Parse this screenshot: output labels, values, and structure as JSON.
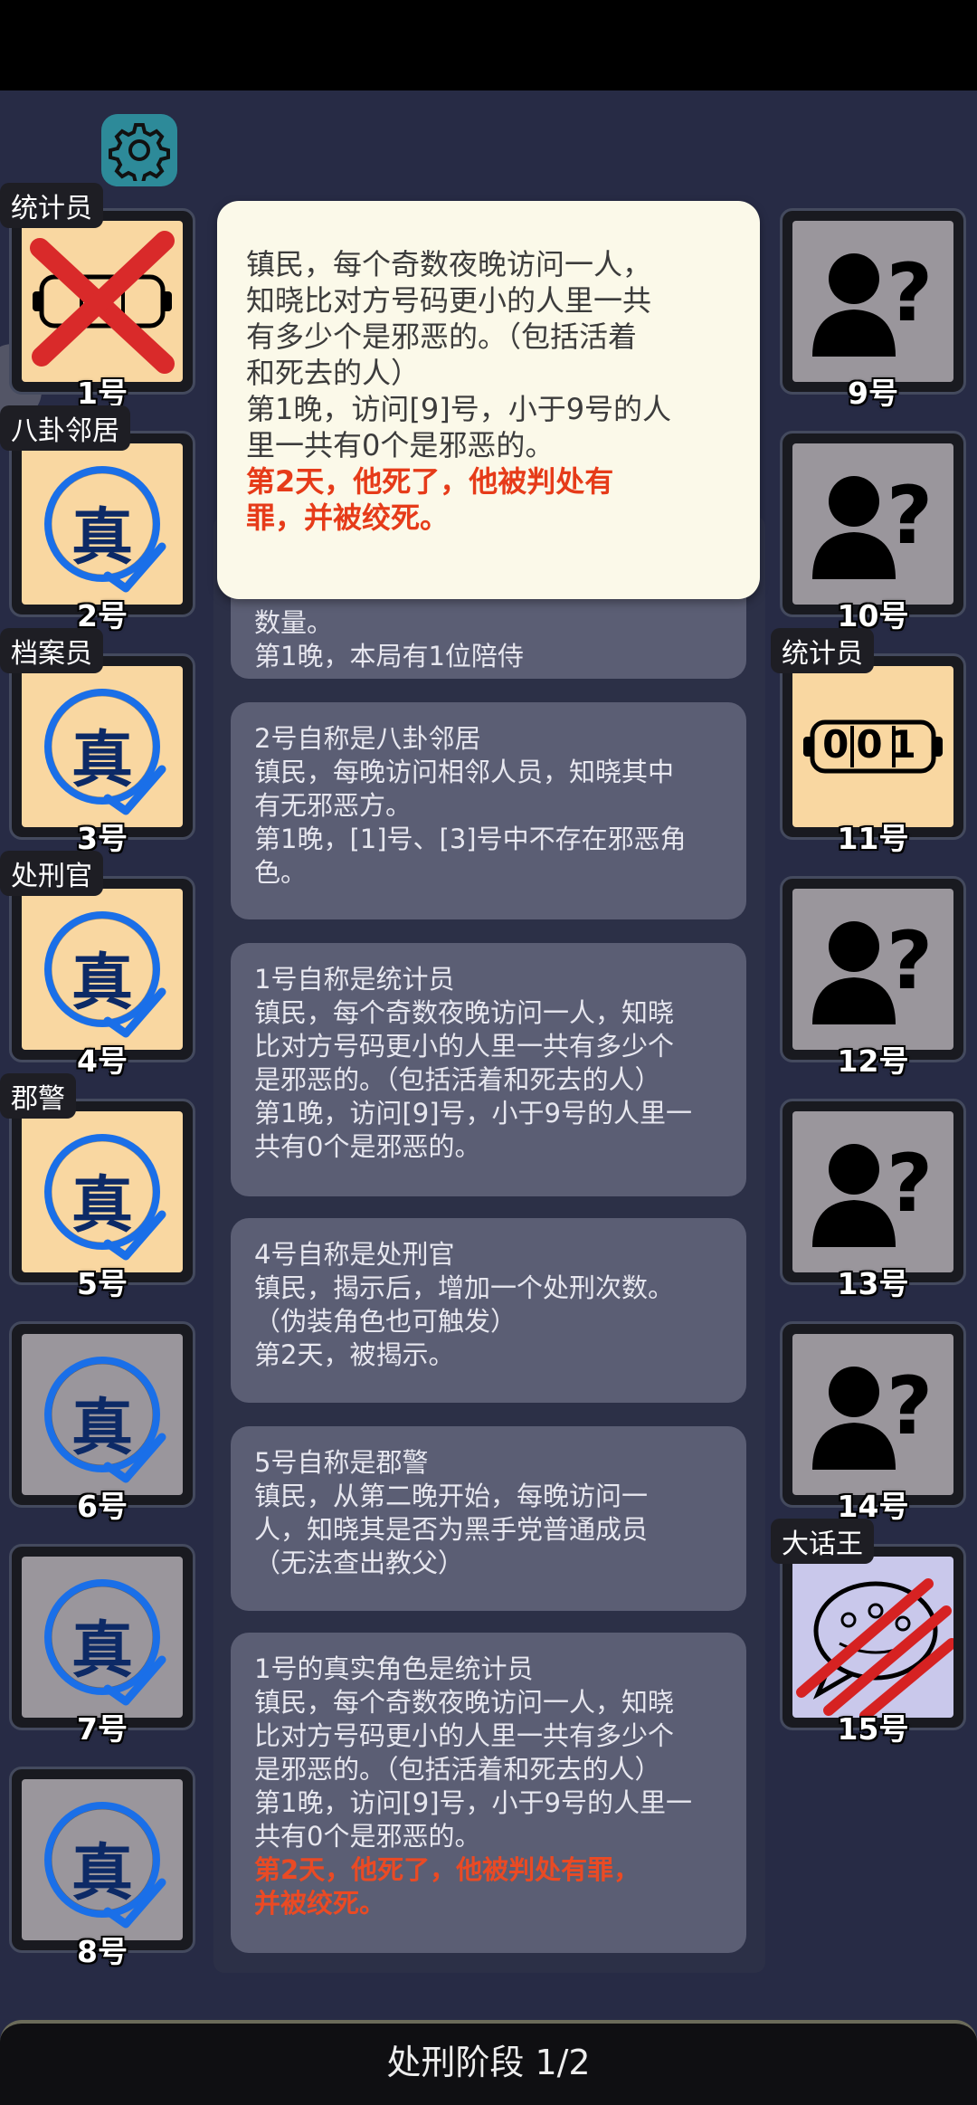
{
  "settings": {
    "icon": "gear-icon"
  },
  "seats": [
    {
      "number": "1号",
      "role_label": "统计员",
      "state": "dead",
      "icon": "counter-icon"
    },
    {
      "number": "2号",
      "role_label": "八卦邻居",
      "state": "verified",
      "badge": "真"
    },
    {
      "number": "3号",
      "role_label": "档案员",
      "state": "verified",
      "badge": "真"
    },
    {
      "number": "4号",
      "role_label": "处刑官",
      "state": "verified",
      "badge": "真"
    },
    {
      "number": "5号",
      "role_label": "郡警",
      "state": "verified",
      "badge": "真"
    },
    {
      "number": "6号",
      "state": "verified",
      "badge": "真"
    },
    {
      "number": "7号",
      "state": "verified",
      "badge": "真"
    },
    {
      "number": "8号",
      "state": "verified",
      "badge": "真"
    },
    {
      "number": "9号",
      "state": "unknown",
      "icon": "unknown-person-icon"
    },
    {
      "number": "10号",
      "state": "unknown",
      "icon": "unknown-person-icon"
    },
    {
      "number": "11号",
      "role_label": "统计员",
      "state": "revealed",
      "icon": "counter-icon",
      "counter_value": "001"
    },
    {
      "number": "12号",
      "state": "unknown",
      "icon": "unknown-person-icon"
    },
    {
      "number": "13号",
      "state": "unknown",
      "icon": "unknown-person-icon"
    },
    {
      "number": "14号",
      "state": "unknown",
      "icon": "unknown-person-icon"
    },
    {
      "number": "15号",
      "role_label": "大话王",
      "state": "attacked",
      "icon": "speech-bubble-icon"
    }
  ],
  "popup": {
    "lines": [
      "镇民，每个奇数夜晚访问一人，",
      "知晓比对方号码更小的人里一共",
      "有多少个是邪恶的。（包括活着",
      "和死去的人）",
      "第1晚，访问[9]号，小于9号的人",
      "里一共有0个是邪恶的。"
    ],
    "red_lines": [
      "第2天，他死了，他被判处有",
      "罪，并被绞死。"
    ]
  },
  "log": {
    "partial": [
      "数量。",
      "第1晚，本局有1位陪侍"
    ],
    "messages": [
      {
        "lines": [
          "2号自称是八卦邻居",
          "镇民，每晚访问相邻人员，知晓其中",
          "有无邪恶方。",
          "第1晚，[1]号、[3]号中不存在邪恶角",
          "色。"
        ]
      },
      {
        "lines": [
          "1号自称是统计员",
          "镇民，每个奇数夜晚访问一人，知晓",
          "比对方号码更小的人里一共有多少个",
          "是邪恶的。（包括活着和死去的人）",
          "第1晚，访问[9]号，小于9号的人里一",
          "共有0个是邪恶的。"
        ]
      },
      {
        "lines": [
          "4号自称是处刑官",
          "镇民，揭示后，增加一个处刑次数。",
          "（伪装角色也可触发）",
          "第2天，被揭示。"
        ]
      },
      {
        "lines": [
          "5号自称是郡警",
          "镇民，从第二晚开始，每晚访问一",
          "人，知晓其是否为黑手党普通成员",
          "（无法查出教父）"
        ]
      },
      {
        "lines": [
          "1号的真实角色是统计员",
          "镇民，每个奇数夜晚访问一人，知晓",
          "比对方号码更小的人里一共有多少个",
          "是邪恶的。（包括活着和死去的人）",
          "第1晚，访问[9]号，小于9号的人里一",
          "共有0个是邪恶的。"
        ],
        "red_lines": [
          "第2天，他死了，他被判处有罪，",
          "并被绞死。"
        ]
      }
    ]
  },
  "phase": {
    "label": "处刑阶段 1/2"
  }
}
